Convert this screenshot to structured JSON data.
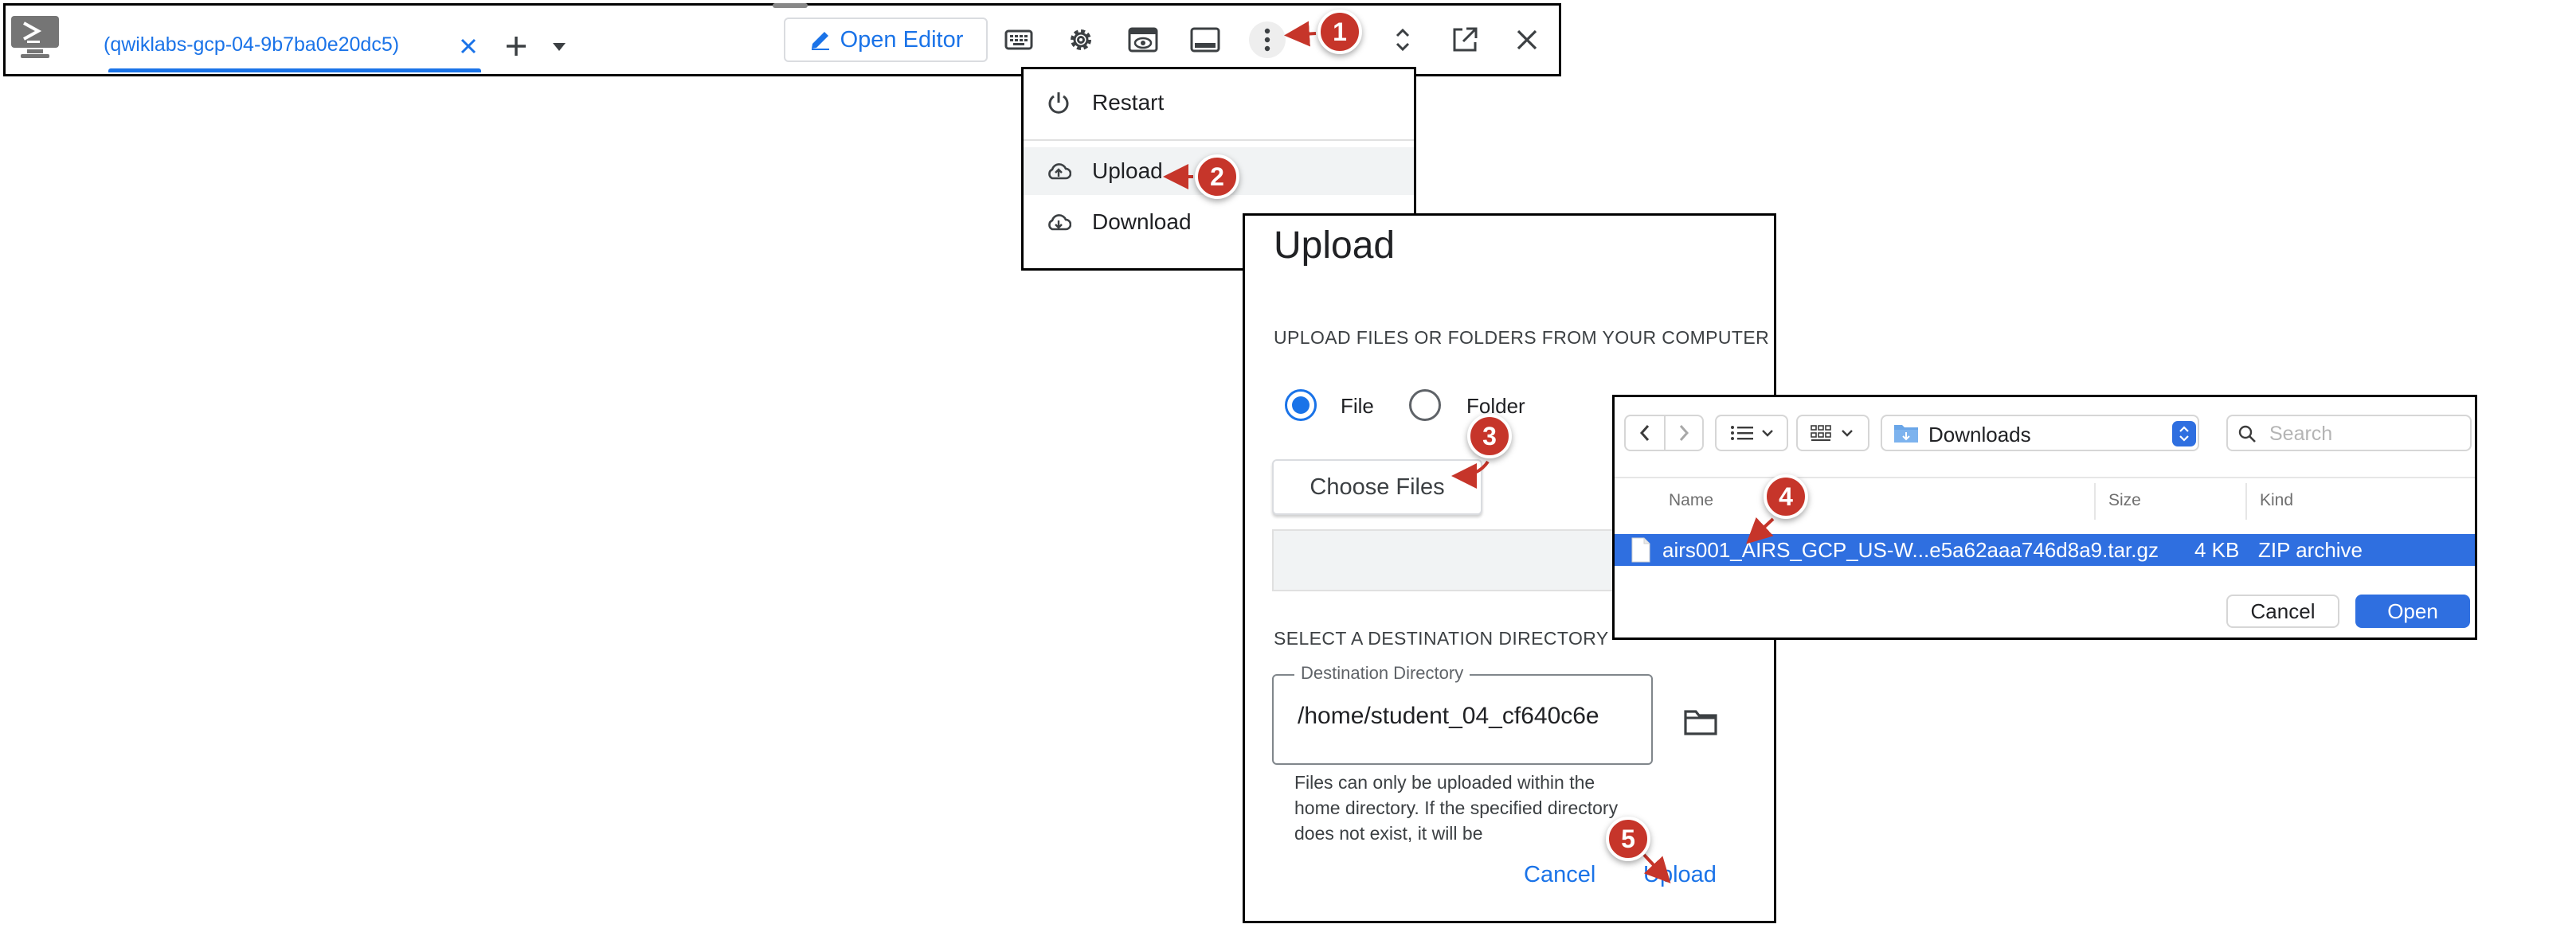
{
  "toolbar": {
    "tab_label": "(qwiklabs-gcp-04-9b7ba0e20dc5)",
    "open_editor_label": "Open Editor"
  },
  "menu": {
    "items": [
      {
        "label": "Restart",
        "icon": "power-icon"
      },
      {
        "label": "Upload",
        "icon": "cloud-upload-icon"
      },
      {
        "label": "Download",
        "icon": "cloud-download-icon"
      }
    ]
  },
  "upload_dialog": {
    "title": "Upload",
    "section1": "UPLOAD FILES OR FOLDERS FROM YOUR COMPUTER",
    "radio_file": "File",
    "radio_folder": "Folder",
    "selected": "File",
    "choose_files": "Choose Files",
    "section2": "SELECT A DESTINATION DIRECTORY",
    "dest_legend": "Destination Directory",
    "dest_value": "/home/student_04_cf640c6e",
    "dest_help": "Files can only be uploaded within the home directory. If the specified directory does not exist, it will be",
    "cancel": "Cancel",
    "upload": "Upload"
  },
  "file_picker": {
    "location": "Downloads",
    "search_placeholder": "Search",
    "columns": [
      "Name",
      "Size",
      "Kind"
    ],
    "file": {
      "name": "airs001_AIRS_GCP_US-W...e5a62aaa746d8a9.tar.gz",
      "size": "4 KB",
      "kind": "ZIP archive"
    },
    "cancel": "Cancel",
    "open": "Open"
  },
  "annotations": {
    "marker_color": "#c6352a",
    "steps": [
      "1",
      "2",
      "3",
      "4",
      "5"
    ]
  },
  "colors": {
    "accent": "#1a73e8",
    "mac_selection": "#2f6fe0"
  }
}
